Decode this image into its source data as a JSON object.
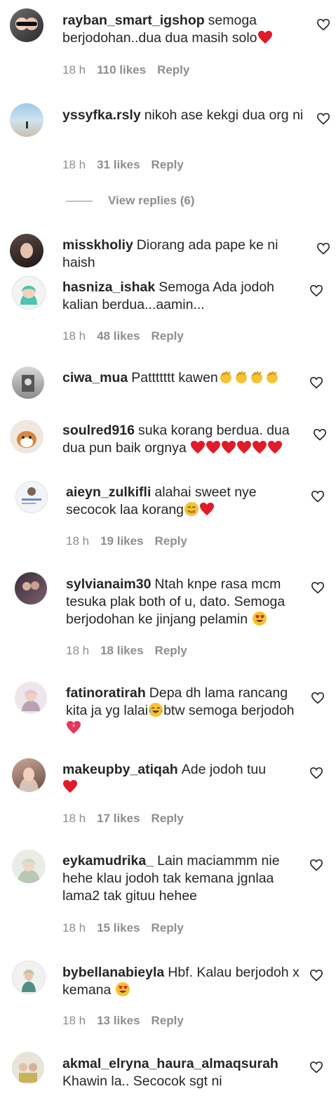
{
  "comments": [
    {
      "username": "rayban_smart_igshop",
      "text": "semoga berjodohan..dua dua masih solo",
      "emoji_after": "❤️",
      "time": "18 h",
      "likes": "110 likes",
      "reply": "Reply"
    },
    {
      "username": "yssyfka.rsly",
      "text": "nikoh ase kekgi dua org ni",
      "time": "18 h",
      "likes": "31 likes",
      "reply": "Reply",
      "view_replies": "View replies (6)"
    },
    {
      "username": "misskholiy",
      "text": "Diorang ada pape ke ni haish"
    },
    {
      "username": "hasniza_ishak",
      "text": "Semoga Ada jodoh kalian berdua...aamin...",
      "time": "18 h",
      "likes": "48 likes",
      "reply": "Reply"
    },
    {
      "username": "ciwa_mua",
      "text": "Pattttttt kawen",
      "emoji_after": "👏👏👏👏"
    },
    {
      "username": "soulred916",
      "text": "suka korang berdua. dua dua pun baik orgnya",
      "emoji_after": "❤️❤️❤️❤️❤️❤️"
    },
    {
      "username": "aieyn_zulkifli",
      "text": "alahai sweet nye secocok laa korang",
      "emoji_after": "😋❤️",
      "time": "18 h",
      "likes": "19 likes",
      "reply": "Reply"
    },
    {
      "username": "sylvianaim30",
      "text": "Ntah knpe rasa mcm tesuka plak both of u, dato. Semoga berjodohan ke jinjang pelamin",
      "emoji_after": "😍",
      "time": "18 h",
      "likes": "18 likes",
      "reply": "Reply"
    },
    {
      "username": "fatinoratirah",
      "text": "Depa dh lama rancang kita ja yg lalai",
      "emoji_mid": "😂",
      "text2": "btw semoga berjodoh",
      "emoji_after": "💖"
    },
    {
      "username": "makeupby_atiqah",
      "text": "Ade jodoh tuu",
      "emoji_after": "❤️",
      "time": "18 h",
      "likes": "17 likes",
      "reply": "Reply"
    },
    {
      "username": "eykamudrika_",
      "text": "Lain maciammm nie hehe klau jodoh tak kemana jgnlaa lama2 tak gituu hehee",
      "time": "18 h",
      "likes": "15 likes",
      "reply": "Reply"
    },
    {
      "username": "bybellanabieyla",
      "text": "Hbf. Kalau berjodoh x kemana",
      "emoji_after": "😍",
      "time": "18 h",
      "likes": "13 likes",
      "reply": "Reply"
    },
    {
      "username": "akmal_elryna_haura_almaqsurah",
      "text": "Khawin la.. Secocok sgt ni"
    }
  ]
}
